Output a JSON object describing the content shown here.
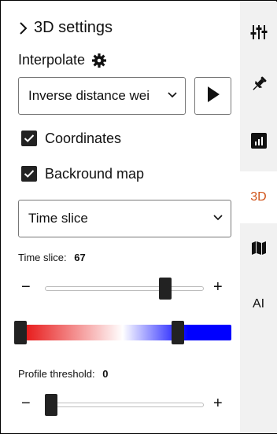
{
  "panel": {
    "section_title": "3D settings",
    "interpolate_label": "Interpolate",
    "method_select": {
      "value": "Inverse distance wei"
    },
    "coordinates": {
      "label": "Coordinates",
      "checked": true
    },
    "background_map": {
      "label": "Backround map",
      "checked": true
    },
    "mode_select": {
      "value": "Time slice"
    },
    "time_slice": {
      "label": "Time slice:",
      "value": "67",
      "position": 0.78
    },
    "color_ramp": {
      "left_stop": 0.0,
      "right_stop": 0.77,
      "colors": [
        "#e50000",
        "#ffffff",
        "#0000ff"
      ]
    },
    "profile_threshold": {
      "label": "Profile threshold:",
      "value": "0",
      "position": 0.0
    },
    "minus_symbol": "−",
    "plus_symbol": "+"
  },
  "rail": {
    "items": [
      {
        "name": "mixer-icon"
      },
      {
        "name": "pin-icon"
      },
      {
        "name": "chart-icon"
      },
      {
        "label": "3D",
        "active": true,
        "color": "#d0541a"
      },
      {
        "name": "map-icon"
      },
      {
        "label": "AI"
      }
    ]
  }
}
